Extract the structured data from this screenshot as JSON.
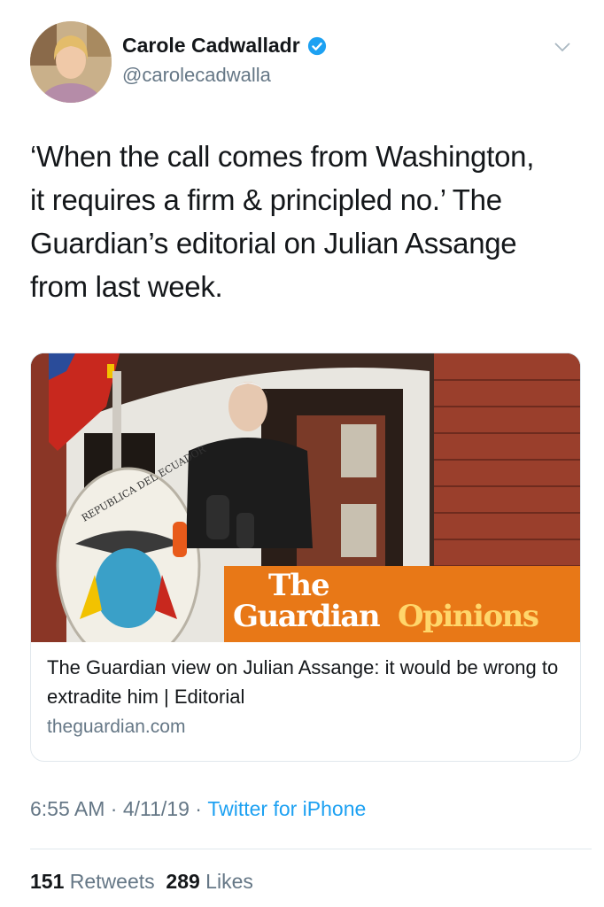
{
  "author": {
    "display_name": "Carole Cadwalladr",
    "handle": "@carolecadwalla",
    "verified": true
  },
  "icons": {
    "verified": "verified-badge-icon",
    "more": "chevron-down-icon"
  },
  "tweet": {
    "text": "‘When the call comes from Washington,\nit requires a firm & principled no.’ The\nGuardian’s editorial on Julian Assange\nfrom last week."
  },
  "card": {
    "title": "The Guardian view on Julian Assange: it would be wrong to extradite him | Editorial",
    "domain": "theguardian.com",
    "image_text": {
      "the": "The",
      "guardian": "Guardian",
      "opinions": "Opinions",
      "seal_text": "REPUBLICA DEL ECUADOR"
    }
  },
  "meta": {
    "time": "6:55 AM",
    "sep1": " · ",
    "date": "4/11/19",
    "sep2": " · ",
    "source": "Twitter for iPhone"
  },
  "stats": {
    "retweets_count": "151",
    "retweets_label": " Retweets",
    "likes_count": "289",
    "likes_label": " Likes"
  },
  "colors": {
    "text": "#14171a",
    "secondary": "#657786",
    "link": "#1da1f2",
    "guardian_orange": "#e87817"
  }
}
